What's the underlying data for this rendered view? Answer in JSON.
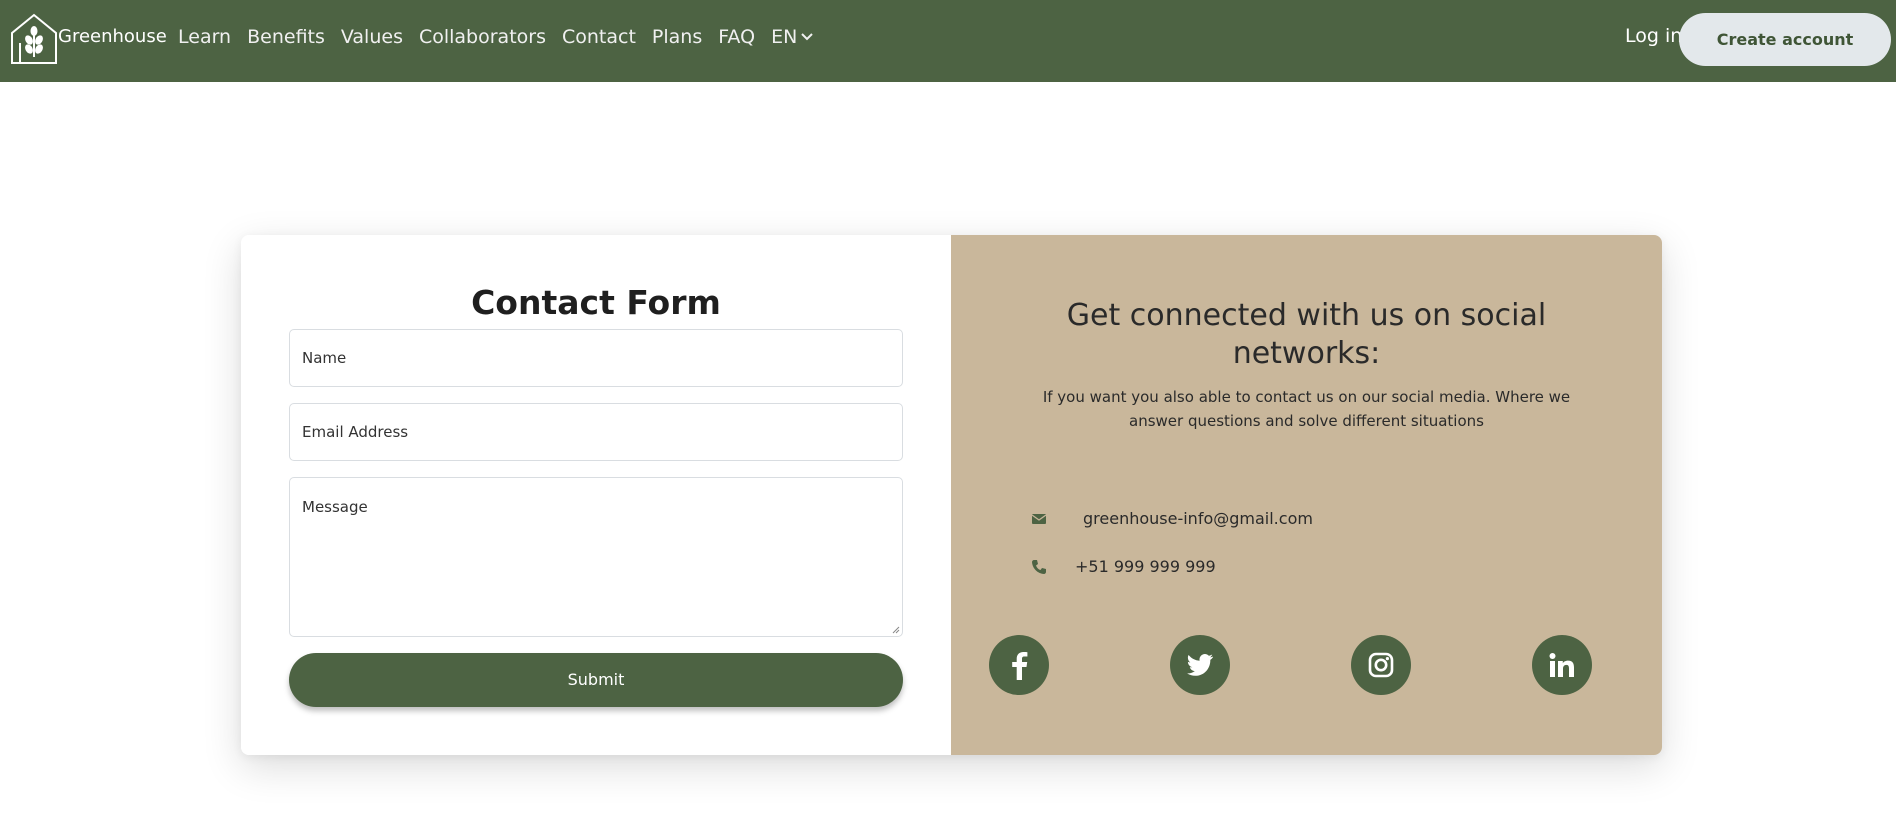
{
  "brand": {
    "name": "Greenhouse"
  },
  "nav": {
    "links": [
      "Learn",
      "Benefits",
      "Values",
      "Collaborators",
      "Contact",
      "Plans",
      "FAQ"
    ],
    "language": "EN",
    "login": "Log in",
    "create_account": "Create account"
  },
  "form": {
    "title": "Contact Form",
    "name_placeholder": "Name",
    "email_placeholder": "Email Address",
    "message_placeholder": "Message",
    "submit_label": "Submit"
  },
  "info": {
    "title": "Get connected with us on social networks:",
    "subtitle": "If you want you also able to contact us on our social media. Where we answer questions and solve different situations",
    "email": "greenhouse-info@gmail.com",
    "phone": "+51 999 999 999",
    "socials": [
      "facebook-icon",
      "twitter-icon",
      "instagram-icon",
      "linkedin-icon"
    ]
  },
  "colors": {
    "primary_green": "#4d6343",
    "tan": "#c9b79b",
    "light_button": "#e3e8eb"
  }
}
